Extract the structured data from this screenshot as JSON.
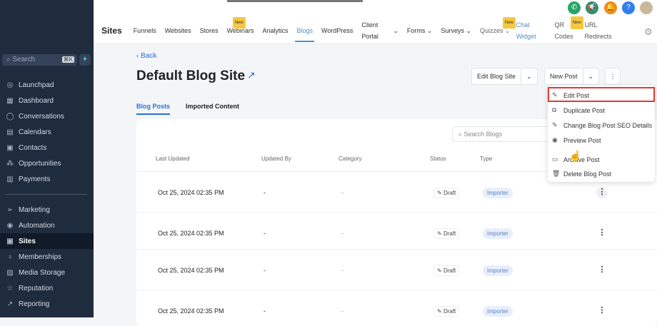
{
  "sidebar": {
    "search_placeholder": "Search",
    "shortcut": "⌘K",
    "items": [
      {
        "label": "Launchpad",
        "icon": "rocket-icon",
        "glyph": "◎"
      },
      {
        "label": "Dashboard",
        "icon": "dashboard-icon",
        "glyph": "▦"
      },
      {
        "label": "Conversations",
        "icon": "chat-icon",
        "glyph": "◯"
      },
      {
        "label": "Calendars",
        "icon": "calendar-icon",
        "glyph": "▤"
      },
      {
        "label": "Contacts",
        "icon": "contacts-icon",
        "glyph": "▣"
      },
      {
        "label": "Opportunities",
        "icon": "opportunities-icon",
        "glyph": "⁂"
      },
      {
        "label": "Payments",
        "icon": "payments-icon",
        "glyph": "▥"
      },
      {
        "label": "Marketing",
        "icon": "send-icon",
        "glyph": "➢"
      },
      {
        "label": "Automation",
        "icon": "automation-icon",
        "glyph": "◉"
      },
      {
        "label": "Sites",
        "icon": "sites-icon",
        "glyph": "▣"
      },
      {
        "label": "Memberships",
        "icon": "award-icon",
        "glyph": "♁"
      },
      {
        "label": "Media Storage",
        "icon": "image-icon",
        "glyph": "▨"
      },
      {
        "label": "Reputation",
        "icon": "star-icon",
        "glyph": "☆"
      },
      {
        "label": "Reporting",
        "icon": "trend-icon",
        "glyph": "↗"
      }
    ]
  },
  "topnav": {
    "section": "Sites",
    "tabs": [
      "Funnels",
      "Websites",
      "Stores",
      "Webinars",
      "Analytics",
      "Blogs",
      "WordPress",
      "Client Portal",
      "Forms",
      "Surveys",
      "Quizzes",
      "Chat Widget",
      "QR Codes",
      "URL Redirects"
    ],
    "new_badge": "New"
  },
  "page": {
    "back": "Back",
    "title": "Default Blog Site",
    "edit_site": "Edit Blog Site",
    "new_post": "New Post",
    "tabs": [
      "Blog Posts",
      "Imported Content"
    ],
    "search_placeholder": "Search Blogs"
  },
  "table": {
    "headers": [
      "Last Updated",
      "Updated By",
      "Category",
      "Status",
      "Type"
    ],
    "rows": [
      {
        "date": "Oct 25, 2024 02:35 PM",
        "by": "-",
        "category": "-",
        "status": "Draft",
        "type": "Importer"
      },
      {
        "date": "Oct 25, 2024 02:35 PM",
        "by": "-",
        "category": "-",
        "status": "Draft",
        "type": "Importer"
      },
      {
        "date": "Oct 25, 2024 02:35 PM",
        "by": "-",
        "category": "-",
        "status": "Draft",
        "type": "Importer"
      },
      {
        "date": "Oct 25, 2024 02:35 PM",
        "by": "-",
        "category": "-",
        "status": "Draft",
        "type": "Importer"
      }
    ]
  },
  "menu": [
    "Edit Post",
    "Duplicate Post",
    "Change Blog Post SEO Details",
    "Preview Post",
    "Archive Post",
    "Delete Blog Post"
  ],
  "colors": {
    "sidebar": "#1f2c3e",
    "accent": "#2a6fd6",
    "highlight": "#e03a2f"
  }
}
